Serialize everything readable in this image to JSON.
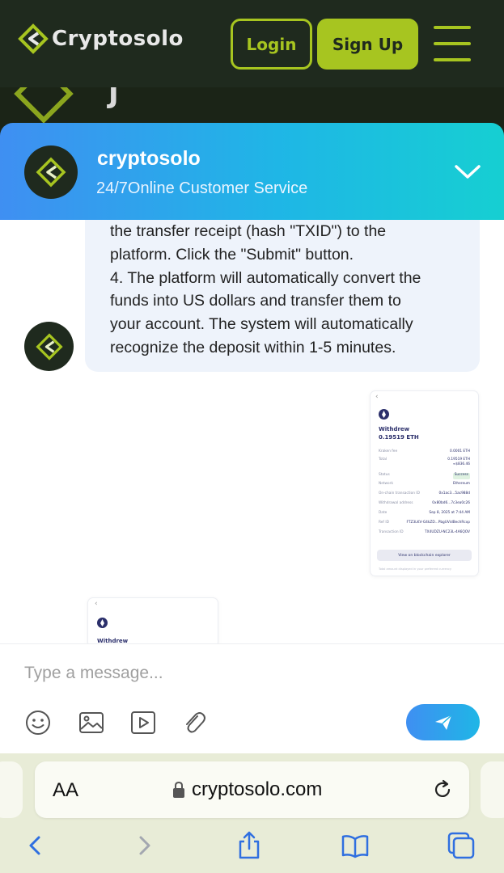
{
  "site": {
    "brand": "Cryptosolo",
    "login_label": "Login",
    "signup_label": "Sign Up",
    "strip_text": "J",
    "accent_color": "#a7c520",
    "header_color": "#1f2a1e"
  },
  "chat": {
    "agent_name": "cryptosolo",
    "agent_subtitle": "24/7Online Customer Service",
    "message_lines": [
      "the transfer receipt (hash \"TXID\") to the",
      "platform. Click the \"Submit\" button.",
      "4. The platform will automatically convert the",
      "funds into US dollars and transfer them to",
      "your account. The system will automatically",
      "recognize the deposit within 1-5 minutes."
    ],
    "receipt": {
      "back": "‹",
      "title_line1": "Withdrew",
      "title_line2": "0.19519 ETH",
      "rows": [
        {
          "label": "Kraken fee",
          "value": "0.0001 ETH"
        },
        {
          "label": "Total",
          "value": "0.19519 ETH"
        },
        {
          "label": "",
          "value": "≈$836.46"
        },
        {
          "label": "Status",
          "value": "Success"
        },
        {
          "label": "Network",
          "value": "Ethereum"
        },
        {
          "label": "On-chain transaction ID",
          "value": "0x1ac3...5ac988d"
        },
        {
          "label": "Withdrawal address",
          "value": "0x80bd6...7c3ea0c26"
        },
        {
          "label": "Date",
          "value": "Sep 8, 2025 at 7:44 AM"
        },
        {
          "label": "Ref ID",
          "value": "FTZ3LKV-G4kZD...PbgUVidBechRcxp"
        },
        {
          "label": "Transaction ID",
          "value": "TX4UDZU-NC23L-4A6QOV"
        }
      ],
      "explorer_button": "View on blockchain explorer",
      "footer_note": "Total amount displayed in your preferred currency"
    },
    "receipt2": {
      "back": "‹",
      "title_line1": "Withdrew"
    },
    "composer_placeholder": "Type a message...",
    "gradient_start": "#3f8ff2",
    "gradient_end": "#16cfd2"
  },
  "browser": {
    "aa_label": "AA",
    "url": "cryptosolo.com"
  },
  "icons": {
    "emoji": "emoji-icon",
    "image": "image-icon",
    "video": "video-icon",
    "attach": "paperclip-icon",
    "send": "send-icon"
  }
}
